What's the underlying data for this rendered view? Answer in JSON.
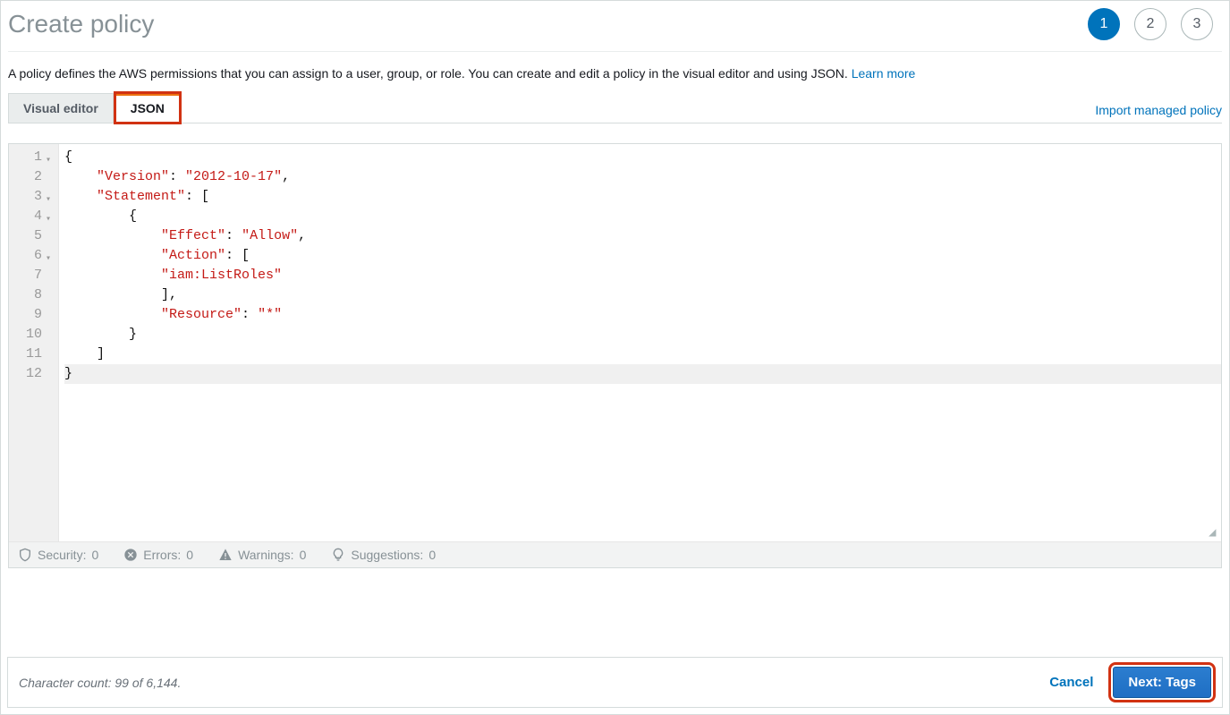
{
  "header": {
    "title": "Create policy",
    "steps": [
      "1",
      "2",
      "3"
    ],
    "activeStep": 0
  },
  "intro": {
    "text": "A policy defines the AWS permissions that you can assign to a user, group, or role. You can create and edit a policy in the visual editor and using JSON. ",
    "learnMore": "Learn more"
  },
  "tabs": {
    "items": [
      {
        "label": "Visual editor",
        "active": false
      },
      {
        "label": "JSON",
        "active": true,
        "highlighted": true
      }
    ],
    "importLink": "Import managed policy"
  },
  "editor": {
    "lines": [
      {
        "n": 1,
        "fold": true,
        "tokens": [
          [
            "pun",
            "{"
          ]
        ]
      },
      {
        "n": 2,
        "fold": false,
        "tokens": [
          [
            "pun",
            "    "
          ],
          [
            "str",
            "\"Version\""
          ],
          [
            "pun",
            ": "
          ],
          [
            "str",
            "\"2012-10-17\""
          ],
          [
            "pun",
            ","
          ]
        ]
      },
      {
        "n": 3,
        "fold": true,
        "tokens": [
          [
            "pun",
            "    "
          ],
          [
            "str",
            "\"Statement\""
          ],
          [
            "pun",
            ": ["
          ]
        ]
      },
      {
        "n": 4,
        "fold": true,
        "tokens": [
          [
            "pun",
            "        {"
          ]
        ]
      },
      {
        "n": 5,
        "fold": false,
        "tokens": [
          [
            "pun",
            "            "
          ],
          [
            "str",
            "\"Effect\""
          ],
          [
            "pun",
            ": "
          ],
          [
            "str",
            "\"Allow\""
          ],
          [
            "pun",
            ","
          ]
        ]
      },
      {
        "n": 6,
        "fold": true,
        "tokens": [
          [
            "pun",
            "            "
          ],
          [
            "str",
            "\"Action\""
          ],
          [
            "pun",
            ": ["
          ]
        ]
      },
      {
        "n": 7,
        "fold": false,
        "tokens": [
          [
            "pun",
            "            "
          ],
          [
            "str",
            "\"iam:ListRoles\""
          ]
        ]
      },
      {
        "n": 8,
        "fold": false,
        "tokens": [
          [
            "pun",
            "            ],"
          ]
        ]
      },
      {
        "n": 9,
        "fold": false,
        "tokens": [
          [
            "pun",
            "            "
          ],
          [
            "str",
            "\"Resource\""
          ],
          [
            "pun",
            ": "
          ],
          [
            "str",
            "\"*\""
          ]
        ]
      },
      {
        "n": 10,
        "fold": false,
        "tokens": [
          [
            "pun",
            "        }"
          ]
        ]
      },
      {
        "n": 11,
        "fold": false,
        "tokens": [
          [
            "pun",
            "    ]"
          ]
        ]
      },
      {
        "n": 12,
        "fold": false,
        "hl": true,
        "tokens": [
          [
            "pun",
            "}"
          ]
        ]
      }
    ]
  },
  "status": {
    "security": {
      "label": "Security:",
      "count": 0
    },
    "errors": {
      "label": "Errors:",
      "count": 0
    },
    "warnings": {
      "label": "Warnings:",
      "count": 0
    },
    "suggestions": {
      "label": "Suggestions:",
      "count": 0
    }
  },
  "footer": {
    "charCount": "Character count: 99 of 6,144.",
    "cancel": "Cancel",
    "next": "Next: Tags"
  }
}
